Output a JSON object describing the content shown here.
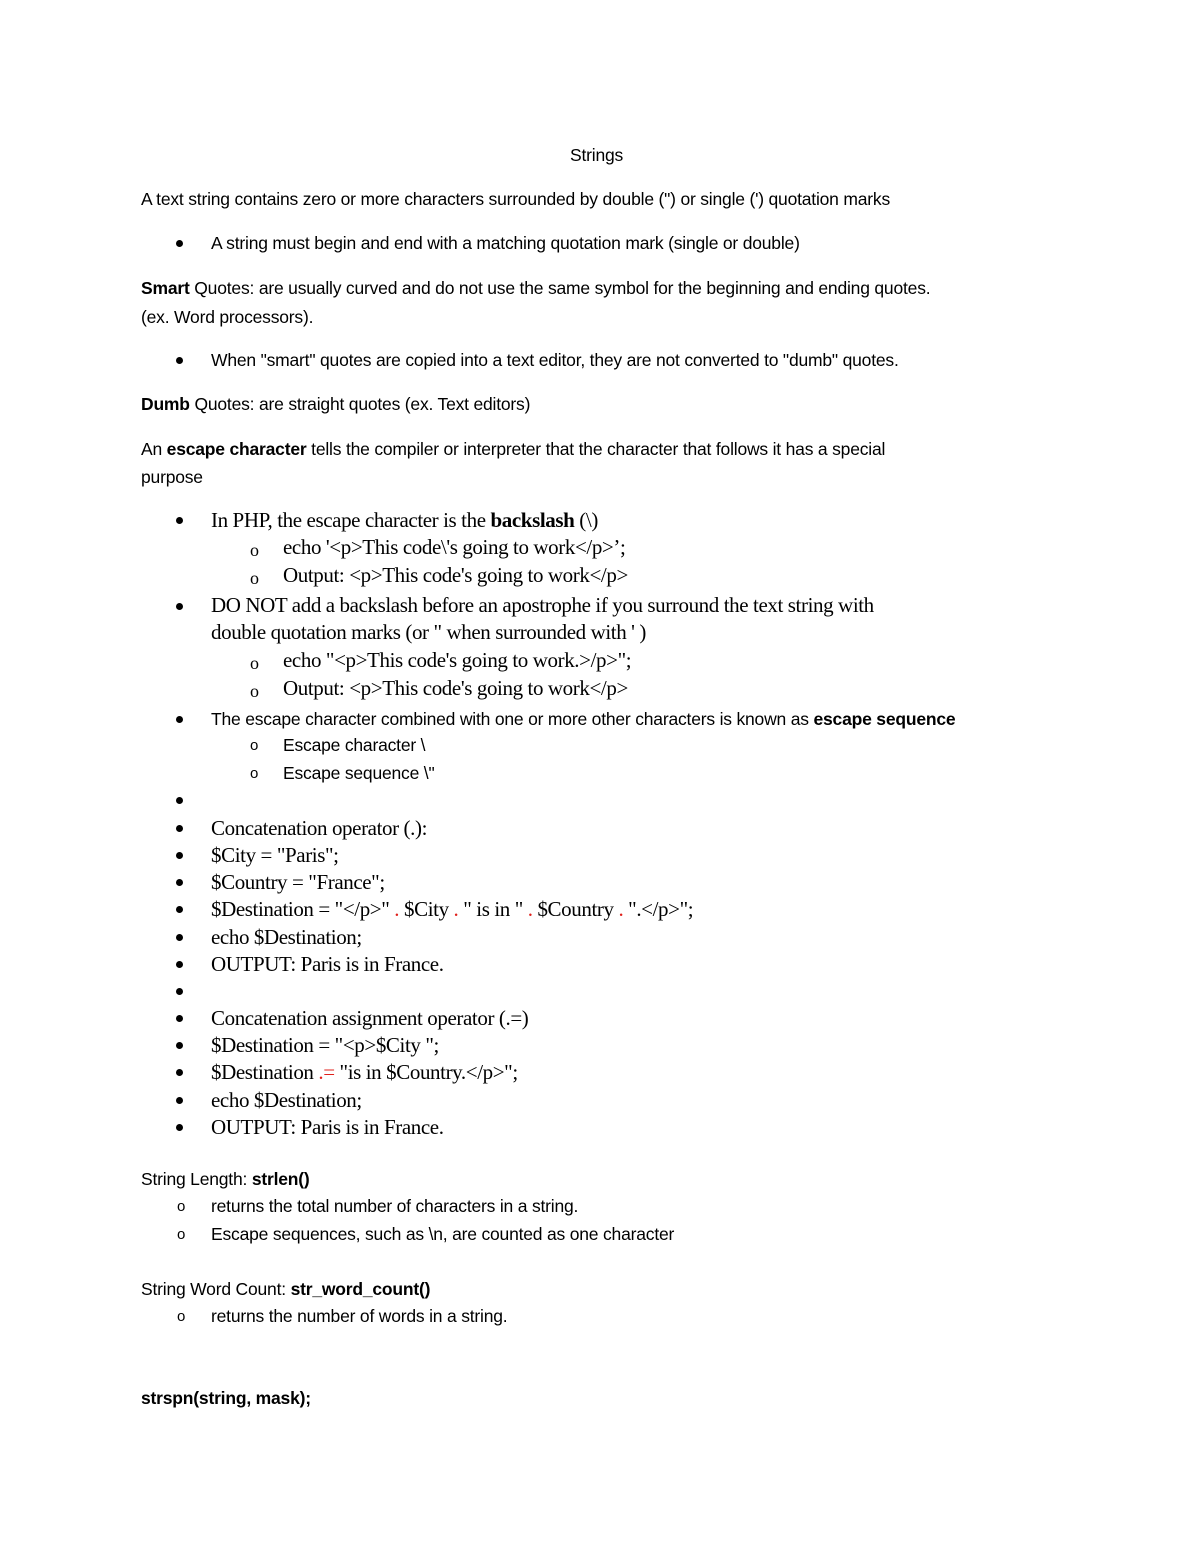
{
  "document": {
    "title": "Strings",
    "intro": "A text string contains zero or more characters surrounded by double (\") or single (') quotation marks",
    "intro_bullet": "A string must begin and end with a matching quotation mark (single or double)",
    "smart_quotes": {
      "term_bold": "Smart",
      "term_rest": " Quotes:",
      "desc": " are usually curved and do not use the same symbol for the beginning and ending quotes.",
      "desc_line2": "(ex. Word processors).",
      "bullet": "When \"smart\" quotes are copied into a text editor, they are not converted to \"dumb\" quotes."
    },
    "dumb_quotes": {
      "term_bold": "Dumb",
      "term_rest": " Quotes:",
      "desc": " are straight quotes (ex. Text editors)"
    },
    "escape": {
      "pre": "An ",
      "term": "escape character",
      "post": " tells the compiler or interpreter that the character that follows it has a special",
      "line2": "purpose",
      "php_bullet_pre": "In PHP, the escape character is the ",
      "php_bullet_bold": "backslash",
      "php_bullet_post": " (\\)",
      "php_sub": [
        "echo '<p>This code\\'s going to work</p>’;",
        "Output: <p>This code's going to work</p>"
      ],
      "donot_line1": "DO NOT add a backslash before an apostrophe if you surround the text string with",
      "donot_line2": "double quotation marks (or \" when surrounded with ' )",
      "donot_sub": [
        "echo \"<p>This code's going to work.>/p>\";",
        "Output: <p>This code's going to work</p>"
      ],
      "seq_bullet_pre": "The escape character combined with one or more other characters is known as ",
      "seq_bullet_bold": "escape sequence",
      "seq_sub": [
        "Escape character \\",
        "Escape sequence \\\""
      ]
    },
    "concat": {
      "items": [
        "Concatenation operator (.):",
        "$City = \"Paris\";",
        "$Country = \"France\";"
      ],
      "destination_parts": [
        "$Destination = \"</p>\" ",
        ".",
        " $City ",
        ".",
        " \" is in \" ",
        ".",
        " $Country ",
        ".",
        " \".</p>\";"
      ],
      "after": [
        "echo $Destination;",
        "OUTPUT: Paris is in France."
      ]
    },
    "concat_assign": {
      "items": [
        "Concatenation assignment operator (.=)",
        "$Destination = \"<p>$City \";"
      ],
      "append_pre": "$Destination ",
      "append_op": ".=",
      "append_post": " \"is in $Country.</p>\";",
      "after": [
        "echo $Destination;",
        "OUTPUT: Paris is in France."
      ]
    },
    "strlen": {
      "label": "String Length: ",
      "func": "strlen()",
      "sub": [
        "returns the total number of characters in a string.",
        "Escape sequences, such as \\n, are counted as one character"
      ]
    },
    "word_count": {
      "label": "String Word Count: ",
      "func": "str_word_count()",
      "sub": [
        "returns the number of words in a string."
      ]
    },
    "strspn": "strspn(string, mask);"
  },
  "colors": {
    "text": "#000000",
    "operator_highlight": "#e0201b"
  }
}
